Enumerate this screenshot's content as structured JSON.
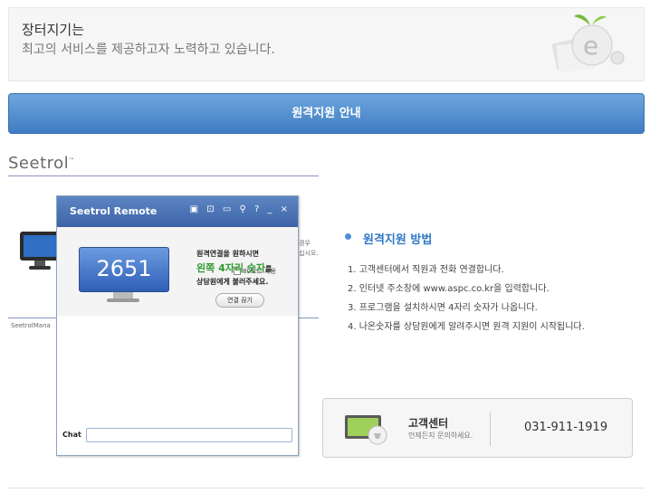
{
  "banner": {
    "title": "장터지기는",
    "subtitle": "최고의 서비스를 제공하고자 노력하고 있습니다."
  },
  "titlebar": {
    "label": "원격지원 안내"
  },
  "brand": {
    "name": "Seetrol",
    "tm": "™"
  },
  "background_window": {
    "text_line1": "경우",
    "text_line2": "십시오.",
    "manager_label": "SeetrolMana"
  },
  "remote_window": {
    "title": "Seetrol Remote",
    "title_icons": "▣ ⊡ ▭ ⚲ ? _ ×",
    "code": "2651",
    "checkbox_label": "80포트 사용",
    "message_line1": "원격연결을 원하시면",
    "message_highlight": "왼쪽 4자리 숫자",
    "message_suffix": "를",
    "message_line3": "상담원에게 불러주세요.",
    "disconnect_button": "연결 끊기",
    "chat_label": "Chat",
    "chat_value": ""
  },
  "method": {
    "title": "원격지원 방법",
    "steps": [
      "1. 고객센터에서 직원과 전화 연결합니다.",
      "2. 인터넷 주소창에 www.aspc.co.kr을 입력합니다.",
      "3. 프로그램을 설치하시면 4자리 숫자가 나옵니다.",
      "4. 나온숫자를 상담원에게 알려주시면 원격 지원이 시작됩니다."
    ]
  },
  "customer_center": {
    "title": "고객센터",
    "subtitle": "언제든지 문의하세요.",
    "phone": "031-911-1919"
  },
  "colors": {
    "accent_blue": "#3f7cc2",
    "highlight_green": "#2f9a2f",
    "method_title": "#2f78c6"
  }
}
